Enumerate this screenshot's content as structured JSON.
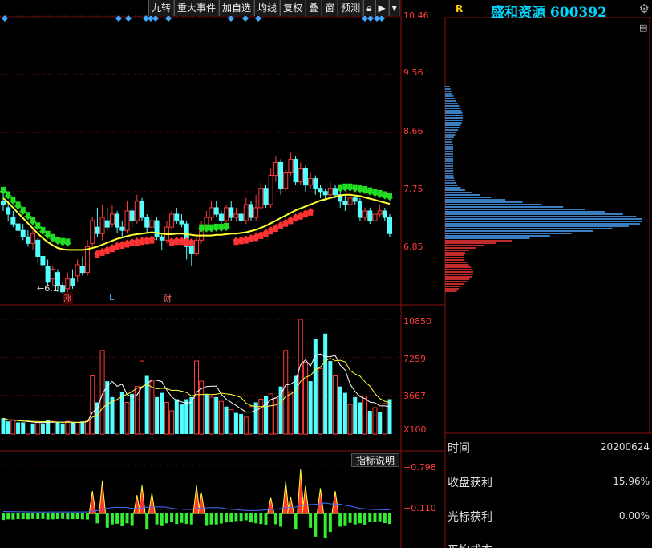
{
  "toolbar": {
    "items": [
      "九转",
      "重大事件",
      "加自选",
      "均线",
      "复权",
      "叠",
      "窗",
      "预测"
    ]
  },
  "stock": {
    "name": "盛和资源",
    "code": "600392",
    "title": "盛和资源 600392",
    "r_label": "R"
  },
  "price_axis": [
    "10.46",
    "9.56",
    "8.66",
    "7.75",
    "6.85"
  ],
  "low_marker": "6.17",
  "volume_axis": [
    "10850",
    "7259",
    "3667",
    "X100"
  ],
  "indicator_axis": [
    "+0.798",
    "+0.110"
  ],
  "indicator_button": "指标说明",
  "events": [
    {
      "label": "涨",
      "color": "red"
    },
    {
      "label": "L",
      "color": "blue"
    },
    {
      "label": "财",
      "color": "red"
    }
  ],
  "info": {
    "rows": [
      {
        "label": "时间",
        "value": "20200624"
      },
      {
        "label": "收盘获利",
        "value": "15.96%"
      },
      {
        "label": "光标获利",
        "value": "0.00%"
      },
      {
        "label": "平均成本",
        "value": ""
      }
    ]
  },
  "colors": {
    "up": "#ff3b3b",
    "down": "#54ffff",
    "ma": "#ffff33",
    "grid": "#7a1010",
    "title": "#00d7ff",
    "chip_up": "#ff3b3b",
    "chip_down": "#4aa8ff"
  },
  "chart_data": {
    "type": "candlestick",
    "price_ticks": [
      10.46,
      9.56,
      8.66,
      7.75,
      6.85
    ],
    "ylim": [
      6.0,
      10.46
    ],
    "candles": [
      [
        7.6,
        7.55,
        7.72,
        7.45
      ],
      [
        7.5,
        7.4,
        7.6,
        7.3
      ],
      [
        7.35,
        7.25,
        7.45,
        7.2
      ],
      [
        7.25,
        7.15,
        7.35,
        7.1
      ],
      [
        7.15,
        7.05,
        7.25,
        7.0
      ],
      [
        7.05,
        6.95,
        7.15,
        6.9
      ],
      [
        6.95,
        7.1,
        7.2,
        6.85
      ],
      [
        7.0,
        6.75,
        7.05,
        6.65
      ],
      [
        6.75,
        6.62,
        6.85,
        6.55
      ],
      [
        6.6,
        6.35,
        6.7,
        6.3
      ],
      [
        6.4,
        6.55,
        6.6,
        6.3
      ],
      [
        6.5,
        6.3,
        6.55,
        6.2
      ],
      [
        6.3,
        6.2,
        6.35,
        6.17
      ],
      [
        6.25,
        6.4,
        6.5,
        6.2
      ],
      [
        6.4,
        6.3,
        6.55,
        6.25
      ],
      [
        6.45,
        6.62,
        6.7,
        6.35
      ],
      [
        6.6,
        6.5,
        6.75,
        6.45
      ],
      [
        6.5,
        6.9,
        7.0,
        6.45
      ],
      [
        6.95,
        7.3,
        7.35,
        6.9
      ],
      [
        7.2,
        7.1,
        7.5,
        7.05
      ],
      [
        7.1,
        7.35,
        7.55,
        7.0
      ],
      [
        7.3,
        7.2,
        7.5,
        7.15
      ],
      [
        7.25,
        7.4,
        7.55,
        7.2
      ],
      [
        7.4,
        7.2,
        7.45,
        7.1
      ],
      [
        7.2,
        7.15,
        7.3,
        7.05
      ],
      [
        7.15,
        7.45,
        7.6,
        7.1
      ],
      [
        7.45,
        7.3,
        7.5,
        7.2
      ],
      [
        7.3,
        7.6,
        7.7,
        7.25
      ],
      [
        7.6,
        7.35,
        7.65,
        7.3
      ],
      [
        7.35,
        7.2,
        7.4,
        7.1
      ],
      [
        7.2,
        7.3,
        7.4,
        7.15
      ],
      [
        7.3,
        7.05,
        7.35,
        7.0
      ],
      [
        7.05,
        7.0,
        7.1,
        6.85
      ],
      [
        7.0,
        7.2,
        7.3,
        6.95
      ],
      [
        7.2,
        7.4,
        7.45,
        7.15
      ],
      [
        7.4,
        7.3,
        7.5,
        7.25
      ],
      [
        7.3,
        7.25,
        7.4,
        7.2
      ],
      [
        7.25,
        6.9,
        7.3,
        6.7
      ],
      [
        6.9,
        6.8,
        7.0,
        6.6
      ],
      [
        6.8,
        7.0,
        7.05,
        6.75
      ],
      [
        7.0,
        7.2,
        7.3,
        6.95
      ],
      [
        7.2,
        7.35,
        7.45,
        7.15
      ],
      [
        7.35,
        7.5,
        7.6,
        7.3
      ],
      [
        7.5,
        7.4,
        7.6,
        7.35
      ],
      [
        7.4,
        7.3,
        7.45,
        7.2
      ],
      [
        7.3,
        7.5,
        7.55,
        7.25
      ],
      [
        7.5,
        7.35,
        7.6,
        7.3
      ],
      [
        7.35,
        7.4,
        7.5,
        7.3
      ],
      [
        7.4,
        7.3,
        7.45,
        7.25
      ],
      [
        7.3,
        7.55,
        7.65,
        7.25
      ],
      [
        7.55,
        7.35,
        7.6,
        7.3
      ],
      [
        7.35,
        7.5,
        7.7,
        7.3
      ],
      [
        7.5,
        7.8,
        7.9,
        7.45
      ],
      [
        7.8,
        7.55,
        7.85,
        7.5
      ],
      [
        7.55,
        8.0,
        8.1,
        7.5
      ],
      [
        8.0,
        8.2,
        8.3,
        7.9
      ],
      [
        8.2,
        7.8,
        8.25,
        7.7
      ],
      [
        7.8,
        8.05,
        8.1,
        7.75
      ],
      [
        8.05,
        8.25,
        8.35,
        8.0
      ],
      [
        8.25,
        7.9,
        8.3,
        7.85
      ],
      [
        7.9,
        8.1,
        8.2,
        7.85
      ],
      [
        8.1,
        7.85,
        8.15,
        7.75
      ],
      [
        7.85,
        7.95,
        8.05,
        7.8
      ],
      [
        7.95,
        7.8,
        8.0,
        7.7
      ],
      [
        7.8,
        7.75,
        7.85,
        7.65
      ],
      [
        7.75,
        7.7,
        7.8,
        7.6
      ],
      [
        7.7,
        7.8,
        7.9,
        7.65
      ],
      [
        7.8,
        7.7,
        7.85,
        7.65
      ],
      [
        7.7,
        7.6,
        7.75,
        7.5
      ],
      [
        7.6,
        7.55,
        7.7,
        7.45
      ],
      [
        7.55,
        7.65,
        7.75,
        7.5
      ],
      [
        7.65,
        7.6,
        7.7,
        7.55
      ],
      [
        7.6,
        7.35,
        7.65,
        7.3
      ],
      [
        7.35,
        7.45,
        7.5,
        7.3
      ],
      [
        7.45,
        7.3,
        7.5,
        7.25
      ],
      [
        7.3,
        7.4,
        7.45,
        7.25
      ],
      [
        7.4,
        7.45,
        7.55,
        7.35
      ],
      [
        7.45,
        7.35,
        7.5,
        7.3
      ],
      [
        7.35,
        7.1,
        7.4,
        7.05
      ]
    ],
    "ma": [
      7.65,
      7.58,
      7.5,
      7.42,
      7.34,
      7.26,
      7.18,
      7.1,
      7.03,
      6.97,
      6.92,
      6.88,
      6.86,
      6.85,
      6.85,
      6.85,
      6.85,
      6.86,
      6.88,
      6.9,
      6.93,
      6.96,
      6.99,
      7.02,
      7.04,
      7.06,
      7.08,
      7.09,
      7.1,
      7.11,
      7.12,
      7.11,
      7.1,
      7.09,
      7.09,
      7.1,
      7.1,
      7.09,
      7.08,
      7.07,
      7.07,
      7.07,
      7.07,
      7.08,
      7.08,
      7.09,
      7.1,
      7.1,
      7.11,
      7.12,
      7.14,
      7.16,
      7.19,
      7.22,
      7.26,
      7.3,
      7.34,
      7.38,
      7.42,
      7.46,
      7.49,
      7.52,
      7.55,
      7.58,
      7.61,
      7.63,
      7.65,
      7.67,
      7.69,
      7.7,
      7.7,
      7.69,
      7.68,
      7.66,
      7.64,
      7.62,
      7.6,
      7.58,
      7.56
    ],
    "volume_ticks": [
      10850,
      7259,
      3667
    ],
    "volumes": [
      1500,
      1200,
      1300,
      1100,
      1100,
      1200,
      1000,
      1100,
      1000,
      1300,
      1200,
      1100,
      1000,
      1200,
      1100,
      1100,
      1200,
      1300,
      5500,
      3000,
      7900,
      5000,
      3500,
      3200,
      4000,
      3000,
      3800,
      4500,
      6900,
      5500,
      5000,
      3500,
      3900,
      3000,
      2200,
      3300,
      2800,
      3300,
      3500,
      6900,
      5000,
      3800,
      3500,
      3500,
      3100,
      2600,
      2300,
      2000,
      1900,
      1600,
      2600,
      3000,
      3300,
      3600,
      3800,
      3400,
      4500,
      7900,
      4000,
      5500,
      10850,
      6800,
      5000,
      9000,
      6200,
      9500,
      6900,
      5500,
      4500,
      3900,
      2800,
      3500,
      3000,
      3600,
      2200,
      2500,
      2100,
      2900,
      3300
    ],
    "volume_up": [
      0,
      0,
      1,
      0,
      0,
      1,
      0,
      1,
      0,
      0,
      1,
      0,
      0,
      1,
      0,
      1,
      0,
      1,
      1,
      0,
      1,
      0,
      0,
      1,
      0,
      1,
      0,
      1,
      1,
      0,
      1,
      0,
      0,
      1,
      1,
      0,
      0,
      0,
      0,
      1,
      1,
      0,
      1,
      0,
      1,
      0,
      1,
      0,
      0,
      1,
      1,
      0,
      1,
      0,
      1,
      1,
      0,
      1,
      1,
      0,
      1,
      1,
      0,
      0,
      1,
      0,
      0,
      1,
      0,
      0,
      1,
      0,
      0,
      1,
      0,
      1,
      0,
      1,
      0
    ],
    "indicator_ticks": [
      0.798,
      0.11
    ]
  }
}
